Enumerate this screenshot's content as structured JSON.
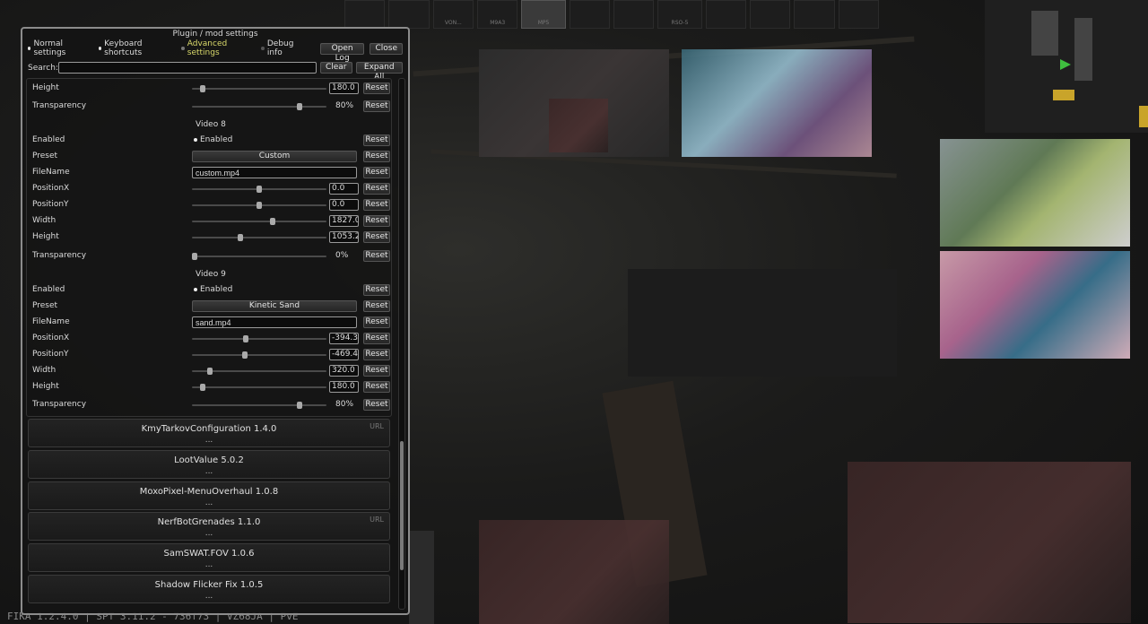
{
  "window": {
    "title": "Plugin / mod settings"
  },
  "tabs": [
    {
      "label": "Normal settings",
      "on": true
    },
    {
      "label": "Keyboard shortcuts",
      "on": true
    },
    {
      "label": "Advanced settings",
      "on": false
    },
    {
      "label": "Debug info",
      "on": false
    }
  ],
  "buttons": {
    "open_log": "Open Log",
    "close": "Close",
    "clear": "Clear",
    "expand_all": "Expand All",
    "reset": "Reset"
  },
  "search": {
    "label": "Search:",
    "value": ""
  },
  "settings": {
    "height_a": {
      "label": "Height",
      "value": "180.0",
      "level": 0.08
    },
    "transparency_a": {
      "label": "Transparency",
      "value": "80%",
      "level": 0.8
    },
    "video8": {
      "header": "Video 8",
      "enabled": {
        "label": "Enabled",
        "value": "Enabled"
      },
      "preset": {
        "label": "Preset",
        "value": "Custom"
      },
      "filename": {
        "label": "FileName",
        "value": "custom.mp4"
      },
      "posx": {
        "label": "PositionX",
        "value": "0.0",
        "level": 0.5
      },
      "posy": {
        "label": "PositionY",
        "value": "0.0",
        "level": 0.5
      },
      "width": {
        "label": "Width",
        "value": "1827.04",
        "level": 0.6
      },
      "height": {
        "label": "Height",
        "value": "1053.23",
        "level": 0.36
      },
      "transparency": {
        "label": "Transparency",
        "value": "0%",
        "level": 0.02
      }
    },
    "video9": {
      "header": "Video 9",
      "enabled": {
        "label": "Enabled",
        "value": "Enabled"
      },
      "preset": {
        "label": "Preset",
        "value": "Kinetic Sand"
      },
      "filename": {
        "label": "FileName",
        "value": "sand.mp4"
      },
      "posx": {
        "label": "PositionX",
        "value": "-394.36",
        "level": 0.4
      },
      "posy": {
        "label": "PositionY",
        "value": "-469.48",
        "level": 0.39
      },
      "width": {
        "label": "Width",
        "value": "320.0",
        "level": 0.13
      },
      "height": {
        "label": "Height",
        "value": "180.0",
        "level": 0.08
      },
      "transparency": {
        "label": "Transparency",
        "value": "80%",
        "level": 0.8
      }
    }
  },
  "plugins": [
    {
      "name": "KmyTarkovConfiguration 1.4.0",
      "dots": "...",
      "url": "URL"
    },
    {
      "name": "LootValue 5.0.2",
      "dots": "...",
      "url": ""
    },
    {
      "name": "MoxoPixel-MenuOverhaul 1.0.8",
      "dots": "...",
      "url": ""
    },
    {
      "name": "NerfBotGrenades 1.1.0",
      "dots": "...",
      "url": "URL"
    },
    {
      "name": "SamSWAT.FOV 1.0.6",
      "dots": "...",
      "url": ""
    },
    {
      "name": "Shadow Flicker Fix 1.0.5",
      "dots": "...",
      "url": ""
    }
  ],
  "background": {
    "weapon_labels": [
      "VON...",
      "M9A3",
      "MP5",
      "RSO-5"
    ],
    "footer": "FIKA 1.2.4.0 | SPT 3.11.2 - 736f73 | VZ68JA | PvE"
  }
}
